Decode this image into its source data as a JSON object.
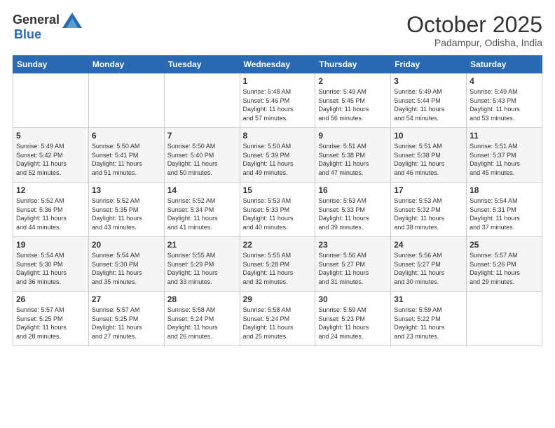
{
  "header": {
    "logo_general": "General",
    "logo_blue": "Blue",
    "month_title": "October 2025",
    "location": "Padampur, Odisha, India"
  },
  "weekdays": [
    "Sunday",
    "Monday",
    "Tuesday",
    "Wednesday",
    "Thursday",
    "Friday",
    "Saturday"
  ],
  "weeks": [
    [
      {
        "day": "",
        "info": ""
      },
      {
        "day": "",
        "info": ""
      },
      {
        "day": "",
        "info": ""
      },
      {
        "day": "1",
        "info": "Sunrise: 5:48 AM\nSunset: 5:46 PM\nDaylight: 11 hours\nand 57 minutes."
      },
      {
        "day": "2",
        "info": "Sunrise: 5:49 AM\nSunset: 5:45 PM\nDaylight: 11 hours\nand 56 minutes."
      },
      {
        "day": "3",
        "info": "Sunrise: 5:49 AM\nSunset: 5:44 PM\nDaylight: 11 hours\nand 54 minutes."
      },
      {
        "day": "4",
        "info": "Sunrise: 5:49 AM\nSunset: 5:43 PM\nDaylight: 11 hours\nand 53 minutes."
      }
    ],
    [
      {
        "day": "5",
        "info": "Sunrise: 5:49 AM\nSunset: 5:42 PM\nDaylight: 11 hours\nand 52 minutes."
      },
      {
        "day": "6",
        "info": "Sunrise: 5:50 AM\nSunset: 5:41 PM\nDaylight: 11 hours\nand 51 minutes."
      },
      {
        "day": "7",
        "info": "Sunrise: 5:50 AM\nSunset: 5:40 PM\nDaylight: 11 hours\nand 50 minutes."
      },
      {
        "day": "8",
        "info": "Sunrise: 5:50 AM\nSunset: 5:39 PM\nDaylight: 11 hours\nand 49 minutes."
      },
      {
        "day": "9",
        "info": "Sunrise: 5:51 AM\nSunset: 5:38 PM\nDaylight: 11 hours\nand 47 minutes."
      },
      {
        "day": "10",
        "info": "Sunrise: 5:51 AM\nSunset: 5:38 PM\nDaylight: 11 hours\nand 46 minutes."
      },
      {
        "day": "11",
        "info": "Sunrise: 5:51 AM\nSunset: 5:37 PM\nDaylight: 11 hours\nand 45 minutes."
      }
    ],
    [
      {
        "day": "12",
        "info": "Sunrise: 5:52 AM\nSunset: 5:36 PM\nDaylight: 11 hours\nand 44 minutes."
      },
      {
        "day": "13",
        "info": "Sunrise: 5:52 AM\nSunset: 5:35 PM\nDaylight: 11 hours\nand 43 minutes."
      },
      {
        "day": "14",
        "info": "Sunrise: 5:52 AM\nSunset: 5:34 PM\nDaylight: 11 hours\nand 41 minutes."
      },
      {
        "day": "15",
        "info": "Sunrise: 5:53 AM\nSunset: 5:33 PM\nDaylight: 11 hours\nand 40 minutes."
      },
      {
        "day": "16",
        "info": "Sunrise: 5:53 AM\nSunset: 5:33 PM\nDaylight: 11 hours\nand 39 minutes."
      },
      {
        "day": "17",
        "info": "Sunrise: 5:53 AM\nSunset: 5:32 PM\nDaylight: 11 hours\nand 38 minutes."
      },
      {
        "day": "18",
        "info": "Sunrise: 5:54 AM\nSunset: 5:31 PM\nDaylight: 11 hours\nand 37 minutes."
      }
    ],
    [
      {
        "day": "19",
        "info": "Sunrise: 5:54 AM\nSunset: 5:30 PM\nDaylight: 11 hours\nand 36 minutes."
      },
      {
        "day": "20",
        "info": "Sunrise: 5:54 AM\nSunset: 5:30 PM\nDaylight: 11 hours\nand 35 minutes."
      },
      {
        "day": "21",
        "info": "Sunrise: 5:55 AM\nSunset: 5:29 PM\nDaylight: 11 hours\nand 33 minutes."
      },
      {
        "day": "22",
        "info": "Sunrise: 5:55 AM\nSunset: 5:28 PM\nDaylight: 11 hours\nand 32 minutes."
      },
      {
        "day": "23",
        "info": "Sunrise: 5:56 AM\nSunset: 5:27 PM\nDaylight: 11 hours\nand 31 minutes."
      },
      {
        "day": "24",
        "info": "Sunrise: 5:56 AM\nSunset: 5:27 PM\nDaylight: 11 hours\nand 30 minutes."
      },
      {
        "day": "25",
        "info": "Sunrise: 5:57 AM\nSunset: 5:26 PM\nDaylight: 11 hours\nand 29 minutes."
      }
    ],
    [
      {
        "day": "26",
        "info": "Sunrise: 5:57 AM\nSunset: 5:25 PM\nDaylight: 11 hours\nand 28 minutes."
      },
      {
        "day": "27",
        "info": "Sunrise: 5:57 AM\nSunset: 5:25 PM\nDaylight: 11 hours\nand 27 minutes."
      },
      {
        "day": "28",
        "info": "Sunrise: 5:58 AM\nSunset: 5:24 PM\nDaylight: 11 hours\nand 26 minutes."
      },
      {
        "day": "29",
        "info": "Sunrise: 5:58 AM\nSunset: 5:24 PM\nDaylight: 11 hours\nand 25 minutes."
      },
      {
        "day": "30",
        "info": "Sunrise: 5:59 AM\nSunset: 5:23 PM\nDaylight: 11 hours\nand 24 minutes."
      },
      {
        "day": "31",
        "info": "Sunrise: 5:59 AM\nSunset: 5:22 PM\nDaylight: 11 hours\nand 23 minutes."
      },
      {
        "day": "",
        "info": ""
      }
    ]
  ]
}
